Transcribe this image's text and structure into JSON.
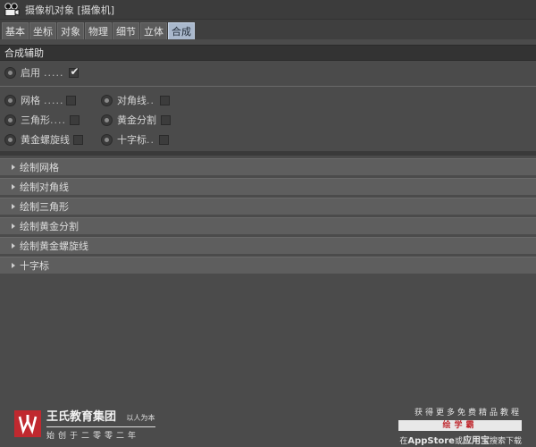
{
  "window": {
    "title": "摄像机对象 [摄像机]"
  },
  "tabs": [
    {
      "label": "基本",
      "active": false
    },
    {
      "label": "坐标",
      "active": false
    },
    {
      "label": "对象",
      "active": false
    },
    {
      "label": "物理",
      "active": false
    },
    {
      "label": "细节",
      "active": false
    },
    {
      "label": "立体",
      "active": false
    },
    {
      "label": "合成",
      "active": true
    }
  ],
  "section": {
    "title": "合成辅助"
  },
  "enable": {
    "label": "启用",
    "dots": ".....",
    "checked": true
  },
  "options": [
    {
      "label": "网格",
      "dots": ".....",
      "checked": false
    },
    {
      "label": "对角线",
      "dots": "..",
      "checked": false
    },
    {
      "label": "三角形",
      "dots": "....",
      "checked": false
    },
    {
      "label": "黄金分割",
      "dots": "",
      "checked": false
    },
    {
      "label": "黄金螺旋线",
      "dots": "",
      "checked": false
    },
    {
      "label": "十字标",
      "dots": "..",
      "checked": false
    }
  ],
  "groups": [
    "绘制网格",
    "绘制对角线",
    "绘制三角形",
    "绘制黄金分割",
    "绘制黄金螺旋线",
    "十字标"
  ],
  "watermark": {
    "left_main": "王氏教育集团",
    "left_slogan": "以人为本",
    "left_line2": "始创于二零零二年",
    "right_line1": "获得更多免费精品教程",
    "right_brand": "绘学霸",
    "right_line3_pre": "在",
    "right_line3_app": "AppStore",
    "right_line3_mid": "或",
    "right_line3_store": "应用宝",
    "right_line3_post": "搜索下载"
  },
  "colors": {
    "panel_bg": "#4b4b4b",
    "active_tab": "#a9b8cc",
    "brand_red": "#c0292f"
  }
}
